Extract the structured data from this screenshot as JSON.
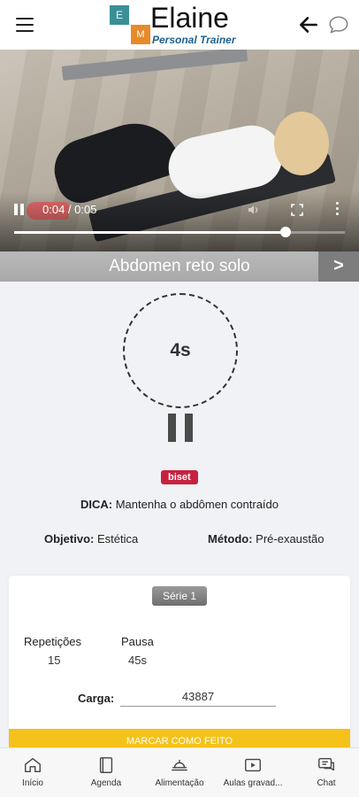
{
  "header": {
    "logo_letter_top": "E",
    "logo_letter_bottom": "M",
    "brand_name": "Elaine",
    "brand_subtitle": "Personal Trainer"
  },
  "video": {
    "time": "0:04 / 0:05",
    "progress": 0.82
  },
  "exercise": {
    "title": "Abdomen reto solo",
    "next_label": ">",
    "timer": "4s",
    "badge": "biset",
    "tip_label": "DICA:",
    "tip_text": " Mantenha o abdômen contraído",
    "objective_label": "Objetivo:",
    "objective_value": " Estética",
    "method_label": "Método:",
    "method_value": " Pré-exaustão"
  },
  "series": {
    "label": "Série 1",
    "reps_label": "Repetições",
    "reps_value": "15",
    "pause_label": "Pausa",
    "pause_value": "45s",
    "load_label": "Carga:",
    "load_value": "43887",
    "done_button": "MARCAR COMO FEITO"
  },
  "nav": {
    "items": [
      {
        "label": "Início",
        "icon": "home-icon"
      },
      {
        "label": "Agenda",
        "icon": "agenda-icon"
      },
      {
        "label": "Alimentação",
        "icon": "food-icon"
      },
      {
        "label": "Aulas gravad...",
        "icon": "video-icon"
      },
      {
        "label": "Chat",
        "icon": "chat-icon"
      }
    ]
  },
  "colors": {
    "badge": "#c8213f",
    "done_button": "#f4c21a",
    "title_bar": "#a9a9a9"
  }
}
